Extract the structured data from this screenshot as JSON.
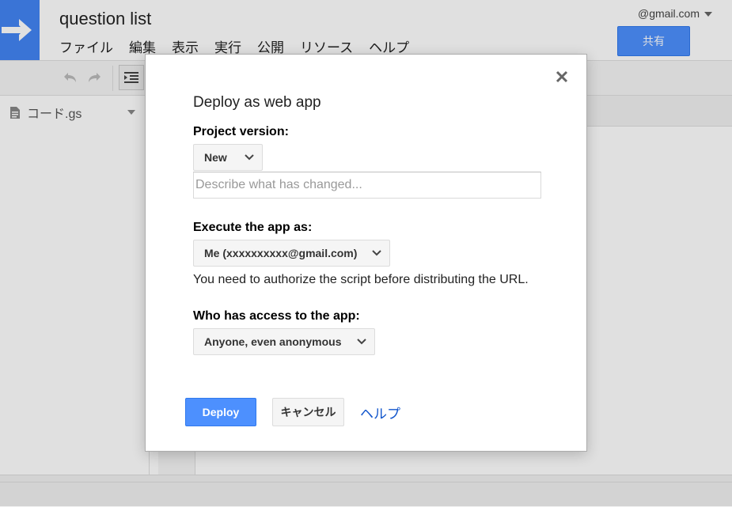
{
  "app": {
    "doc_title": "question list",
    "account": "@gmail.com",
    "share_label": "共有",
    "menu": [
      "ファイル",
      "編集",
      "表示",
      "実行",
      "公開",
      "リソース",
      "ヘルプ"
    ],
    "file_name": "コード.gs"
  },
  "dialog": {
    "title": "Deploy as web app",
    "close_icon": "close-icon",
    "project_version": {
      "label": "Project version:",
      "selected": "New",
      "description_placeholder": "Describe what has changed...",
      "description_value": ""
    },
    "execute_as": {
      "label": "Execute the app as:",
      "selected": "Me (xxxxxxxxxx@gmail.com)",
      "note": "You need to authorize the script before distributing the URL."
    },
    "access": {
      "label": "Who has access to the app:",
      "selected": "Anyone, even anonymous"
    },
    "buttons": {
      "deploy": "Deploy",
      "cancel": "キャンセル",
      "help": "ヘルプ"
    }
  },
  "colors": {
    "brand_blue": "#4285f4",
    "primary_button": "#4d90fe",
    "link": "#1155cc"
  }
}
